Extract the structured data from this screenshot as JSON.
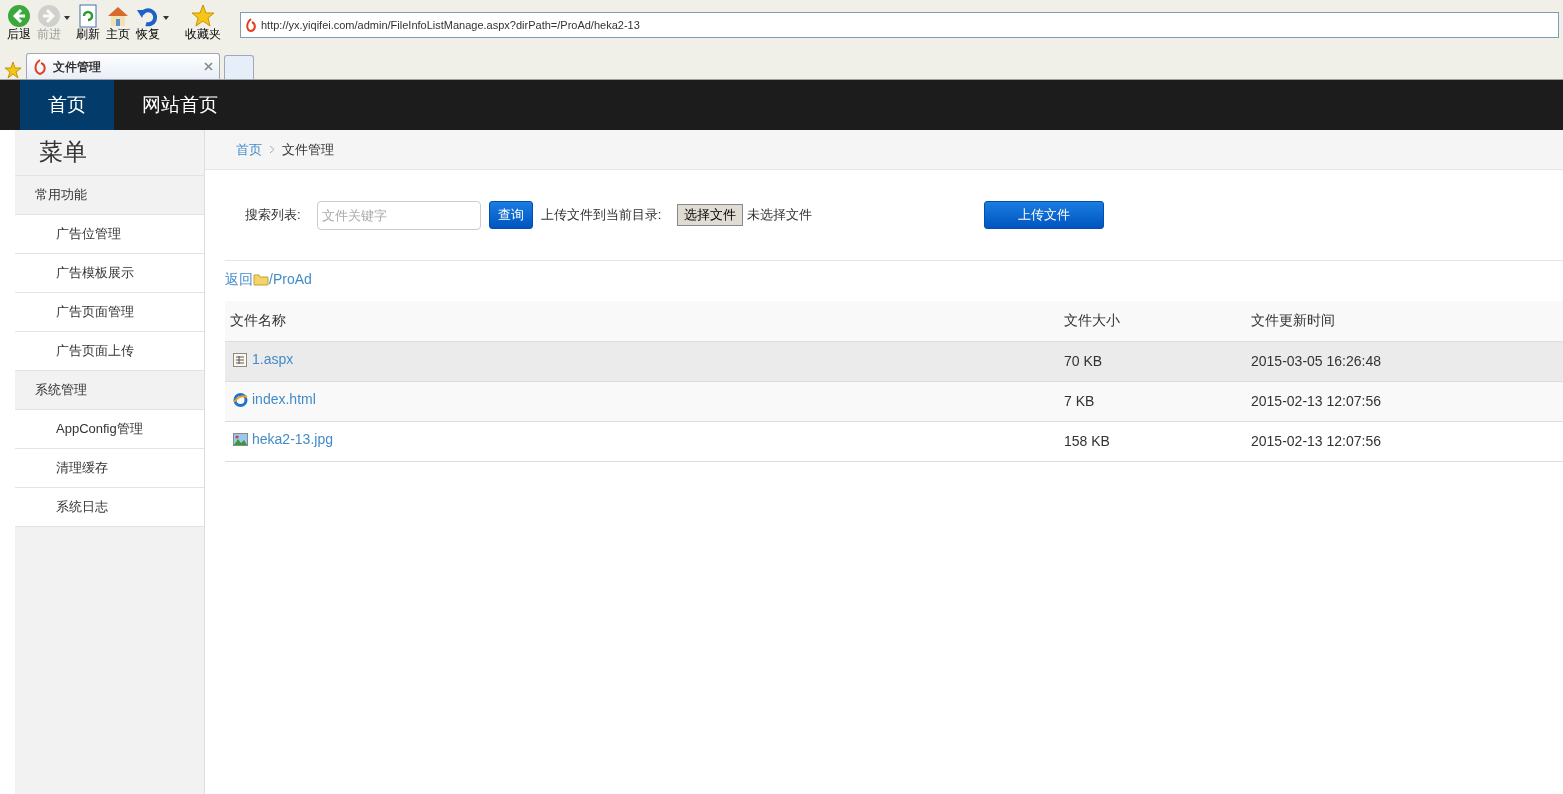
{
  "browser": {
    "toolbar": [
      {
        "label": "后退",
        "kind": "back",
        "disabled": false,
        "has_menu": false
      },
      {
        "label": "前进",
        "kind": "forward",
        "disabled": true,
        "has_menu": true
      },
      {
        "label": "刷新",
        "kind": "refresh",
        "disabled": false,
        "has_menu": false
      },
      {
        "label": "主页",
        "kind": "home",
        "disabled": false,
        "has_menu": false
      },
      {
        "label": "恢复",
        "kind": "undo",
        "disabled": false,
        "has_menu": true
      },
      {
        "label": "收藏夹",
        "kind": "favorites",
        "disabled": false,
        "has_menu": false
      }
    ],
    "address": "http://yx.yiqifei.com/admin/FileInfoListManage.aspx?dirPath=/ProAd/heka2-13",
    "tabs": [
      {
        "title": "文件管理",
        "selected": true
      }
    ]
  },
  "navbar": {
    "items": [
      {
        "label": "首页",
        "selected": true
      },
      {
        "label": "网站首页",
        "selected": false
      }
    ]
  },
  "sidebar": {
    "title": "菜单",
    "groups": [
      {
        "label": "常用功能",
        "items": [
          "广告位管理",
          "广告模板展示",
          "广告页面管理",
          "广告页面上传"
        ]
      },
      {
        "label": "系统管理",
        "items": [
          "AppConfig管理",
          "清理缓存",
          "系统日志"
        ]
      }
    ]
  },
  "breadcrumb": [
    "首页",
    "文件管理"
  ],
  "toolbar": {
    "search_label": "搜索列表:",
    "search_placeholder": "文件关键字",
    "search_button": "查询",
    "upload_label": "上传文件到当前目录:",
    "choose_button": "选择文件",
    "choose_status": "未选择文件",
    "upload_button": "上传文件"
  },
  "path": {
    "back": "返回",
    "dir": "/ProAd"
  },
  "table": {
    "columns": [
      "文件名称",
      "文件大小",
      "文件更新时间"
    ],
    "rows": [
      {
        "name": "1.aspx",
        "kind": "page",
        "size": "70 KB",
        "time": "2015-03-05 16:26:48",
        "selected": true
      },
      {
        "name": "index.html",
        "kind": "html",
        "size": "7 KB",
        "time": "2015-02-13 12:07:56",
        "selected": false
      },
      {
        "name": "heka2-13.jpg",
        "kind": "image",
        "size": "158 KB",
        "time": "2015-02-13 12:07:56",
        "selected": false
      }
    ]
  }
}
